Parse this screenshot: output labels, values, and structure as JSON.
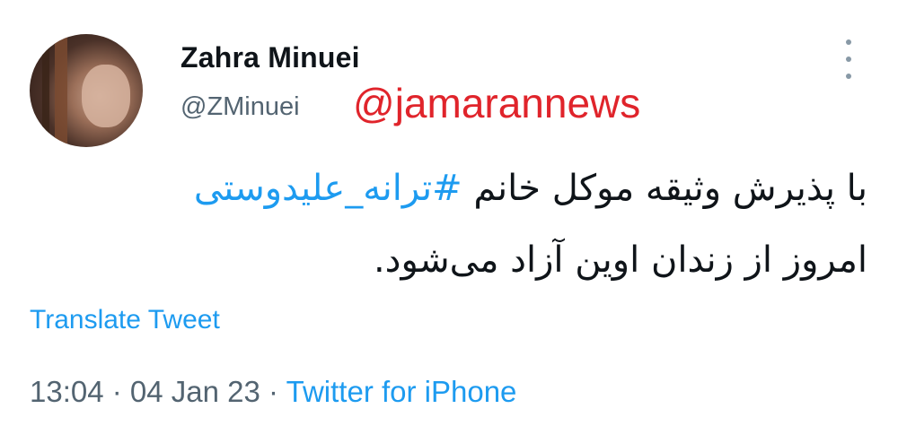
{
  "author": {
    "name": "Zahra Minuei",
    "handle": "@ZMinuei"
  },
  "watermark": "@jamarannews",
  "tweet": {
    "line1_text": "با پذیرش وثیقه موکل خانم ",
    "hashtag": "#ترانه_علیدوستی",
    "line2_text": "امروز از زندان اوین آزاد می‌شود."
  },
  "translate_label": "Translate Tweet",
  "meta": {
    "time": "13:04",
    "separator": " · ",
    "date": "04 Jan 23",
    "source": "Twitter for iPhone"
  },
  "icons": {
    "more": "more-vertical-icon"
  },
  "colors": {
    "link": "#1d9bf0",
    "watermark": "#e0242b",
    "secondary_text": "#536471"
  }
}
